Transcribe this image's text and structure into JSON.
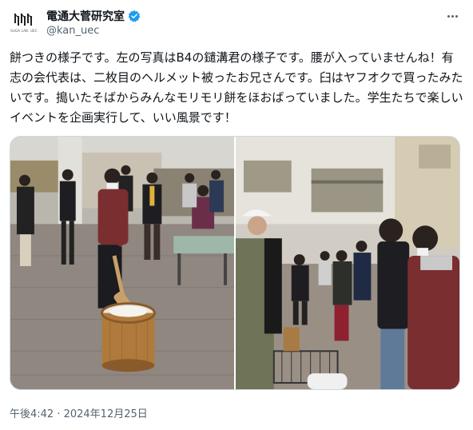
{
  "account": {
    "display_name": "電通大菅研究室",
    "handle": "@kan_uec",
    "avatar_caption": "SUGA LAB. UEC",
    "verified_icon": "verified-badge-icon",
    "verified_color": "#1d9bf0"
  },
  "tweet": {
    "text": "餅つきの様子です。左の写真はB4の鑓溝君の様子です。腰が入っていませんね！有志の会代表は、二枚目のヘルメット被ったお兄さんです。臼はヤフオクで買ったみたいです。搗いたそばからみんなモリモリ餅をほおばっていました。学生たちで楽しいイベントを企画実行して、いい風景です！",
    "timestamp": "午後4:42 · 2024年12月25日"
  },
  "media": {
    "photos": [
      {
        "icon": "photo-mochi-pounding"
      },
      {
        "icon": "photo-students-eating"
      }
    ]
  },
  "colors": {
    "text": "#0f1419",
    "secondary": "#536471",
    "border": "#cfd9de"
  }
}
